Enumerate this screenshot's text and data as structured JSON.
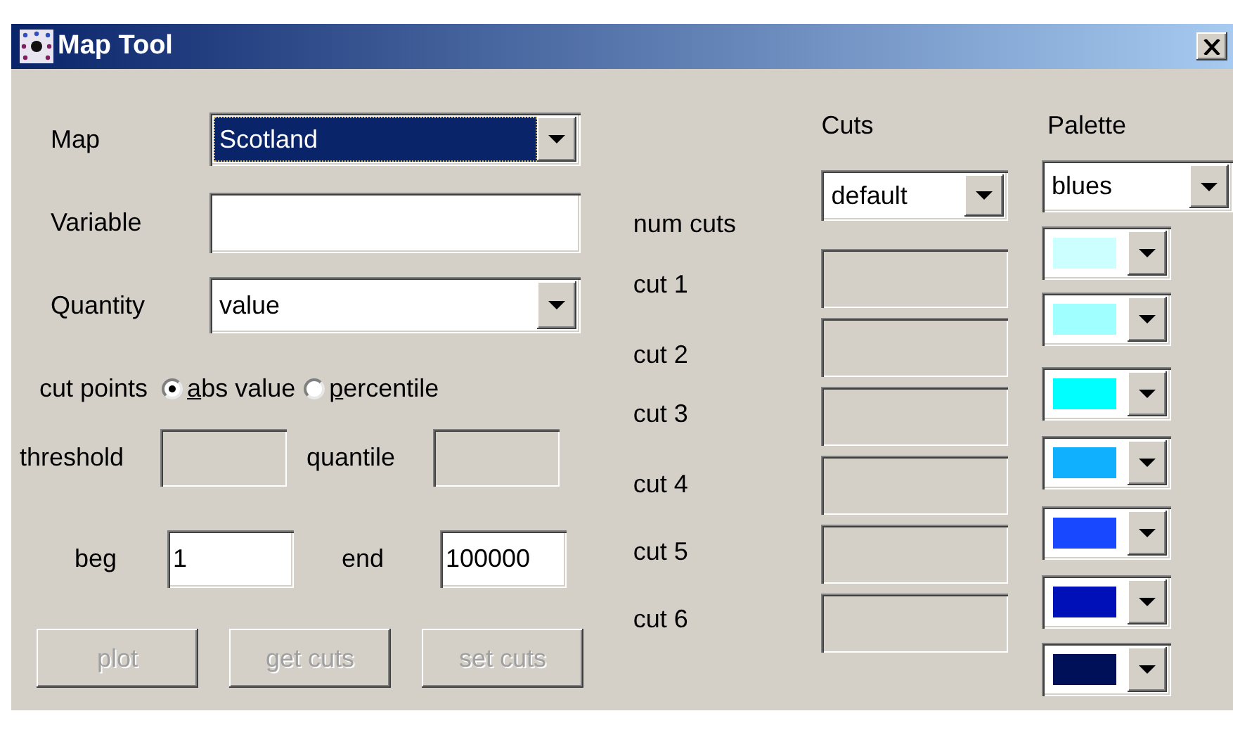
{
  "window": {
    "title": "Map Tool"
  },
  "form": {
    "map": {
      "label": "Map",
      "value": "Scotland",
      "focused": true
    },
    "variable": {
      "label": "Variable"
    },
    "quantity": {
      "label": "Quantity",
      "value": "value"
    },
    "cut_points": {
      "label": "cut points",
      "options": [
        {
          "label": "abs value",
          "selected": true
        },
        {
          "label": "percentile",
          "selected": false
        }
      ]
    },
    "threshold": {
      "label": "threshold",
      "disabled": true
    },
    "quantile": {
      "label": "quantile",
      "disabled": true
    },
    "beg": {
      "label": "beg",
      "value": "1"
    },
    "end": {
      "label": "end",
      "value": "100000"
    },
    "buttons": [
      {
        "label": "plot",
        "disabled": true
      },
      {
        "label": "get cuts",
        "disabled": true
      },
      {
        "label": "set cuts",
        "disabled": true
      }
    ]
  },
  "cuts": {
    "title": "Cuts",
    "num_cuts": {
      "label": "num cuts",
      "value": "default"
    },
    "fields": [
      {
        "label": "cut 1",
        "disabled": true
      },
      {
        "label": "cut 2",
        "disabled": true
      },
      {
        "label": "cut 3",
        "disabled": true
      },
      {
        "label": "cut 4",
        "disabled": true
      },
      {
        "label": "cut 5",
        "disabled": true
      },
      {
        "label": "cut 6",
        "disabled": true
      }
    ]
  },
  "palette": {
    "title": "Palette",
    "value": "blues",
    "colors": [
      {
        "color": "#ccffff"
      },
      {
        "color": "#a0ffff"
      },
      {
        "color": "#00ffff"
      },
      {
        "color": "#10b0ff"
      },
      {
        "color": "#1848ff"
      },
      {
        "color": "#0010b8"
      },
      {
        "color": "#001058"
      }
    ]
  }
}
